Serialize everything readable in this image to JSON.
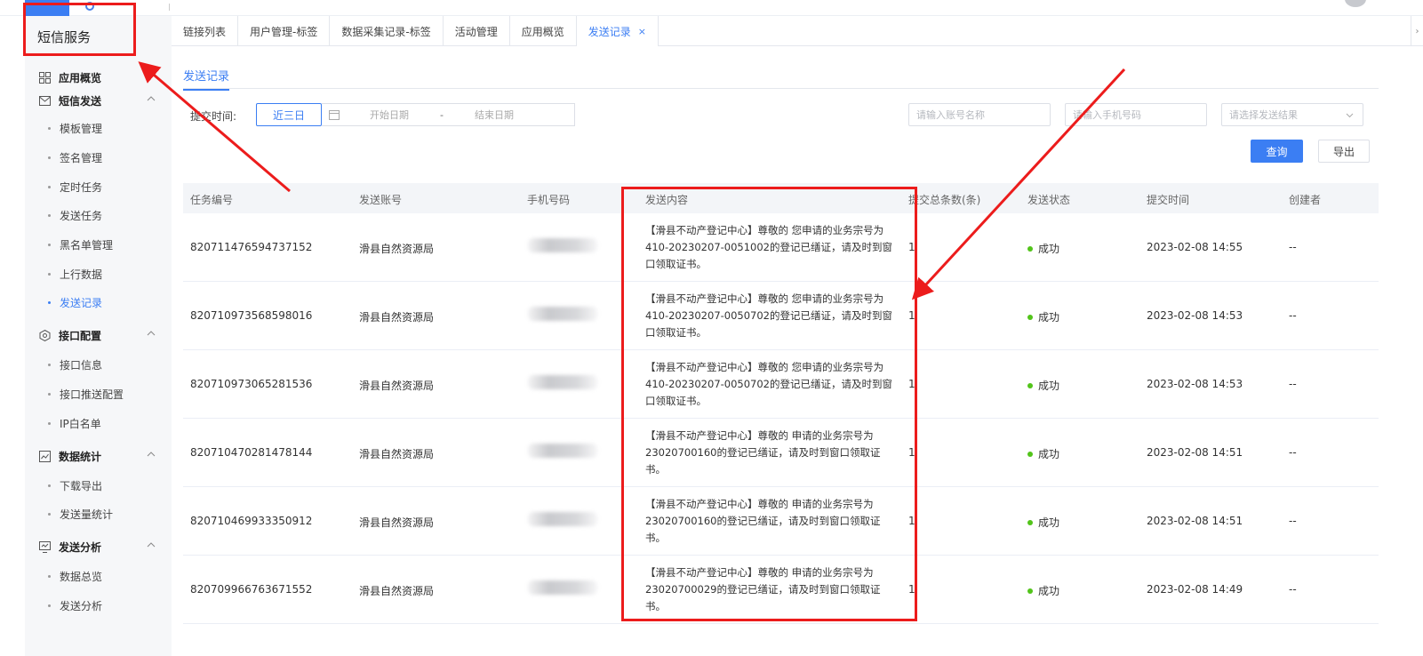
{
  "sidebar": {
    "title": "短信服务",
    "groups": [
      {
        "label": "应用概览",
        "icon": "grid-icon",
        "items": []
      },
      {
        "label": "短信发送",
        "icon": "mail-icon",
        "items": [
          "模板管理",
          "签名管理",
          "定时任务",
          "发送任务",
          "黑名单管理",
          "上行数据",
          "发送记录"
        ]
      },
      {
        "label": "接口配置",
        "icon": "shield-icon",
        "items": [
          "接口信息",
          "接口推送配置",
          "IP白名单"
        ]
      },
      {
        "label": "数据统计",
        "icon": "chart-icon",
        "items": [
          "下载导出",
          "发送量统计"
        ]
      },
      {
        "label": "发送分析",
        "icon": "monitor-icon",
        "items": [
          "数据总览",
          "发送分析"
        ]
      }
    ],
    "active_item": "发送记录"
  },
  "tabs": [
    {
      "label": "链接列表"
    },
    {
      "label": "用户管理-标签"
    },
    {
      "label": "数据采集记录-标签"
    },
    {
      "label": "活动管理"
    },
    {
      "label": "应用概览"
    },
    {
      "label": "发送记录",
      "active": true,
      "close": "×"
    }
  ],
  "page": {
    "title": "发送记录"
  },
  "filters": {
    "time_label": "提交时间:",
    "range_button": "近三日",
    "start_placeholder": "开始日期",
    "range_separator": "-",
    "end_placeholder": "结束日期",
    "account_placeholder": "请输入账号名称",
    "phone_placeholder": "请输入手机号码",
    "result_placeholder": "请选择发送结果",
    "query_button": "查询",
    "export_button": "导出"
  },
  "table": {
    "headers": [
      "任务编号",
      "发送账号",
      "手机号码",
      "发送内容",
      "提交总条数(条)",
      "发送状态",
      "提交时间",
      "创建者"
    ],
    "rows": [
      {
        "task_id": "820711476594737152",
        "account": "滑县自然资源局",
        "content": "【滑县不动产登记中心】尊敬的        您申请的业务宗号为410-20230207-0051002的登记已缮证，请及时到窗口领取证书。",
        "count": "1",
        "status": "成功",
        "time": "2023-02-08 14:55",
        "creator": "--"
      },
      {
        "task_id": "820710973568598016",
        "account": "滑县自然资源局",
        "content": "【滑县不动产登记中心】尊敬的        您申请的业务宗号为410-20230207-0050702的登记已缮证，请及时到窗口领取证书。",
        "count": "1",
        "status": "成功",
        "time": "2023-02-08 14:53",
        "creator": "--"
      },
      {
        "task_id": "820710973065281536",
        "account": "滑县自然资源局",
        "content": "【滑县不动产登记中心】尊敬的        您申请的业务宗号为410-20230207-0050702的登记已缮证，请及时到窗口领取证书。",
        "count": "1",
        "status": "成功",
        "time": "2023-02-08 14:53",
        "creator": "--"
      },
      {
        "task_id": "820710470281478144",
        "account": "滑县自然资源局",
        "content": "【滑县不动产登记中心】尊敬的        申请的业务宗号为23020700160的登记已缮证，请及时到窗口领取证书。",
        "count": "1",
        "status": "成功",
        "time": "2023-02-08 14:51",
        "creator": "--"
      },
      {
        "task_id": "820710469933350912",
        "account": "滑县自然资源局",
        "content": "【滑县不动产登记中心】尊敬的        申请的业务宗号为23020700160的登记已缮证，请及时到窗口领取证书。",
        "count": "1",
        "status": "成功",
        "time": "2023-02-08 14:51",
        "creator": "--"
      },
      {
        "task_id": "820709966763671552",
        "account": "滑县自然资源局",
        "content": "【滑县不动产登记中心】尊敬的        申请的业务宗号为23020700029的登记已缮证，请及时到窗口领取证书。",
        "count": "1",
        "status": "成功",
        "time": "2023-02-08 14:49",
        "creator": "--"
      }
    ]
  },
  "colors": {
    "accent": "#3b7ef3",
    "success": "#52c41a",
    "annotation": "#ec1c1c"
  }
}
